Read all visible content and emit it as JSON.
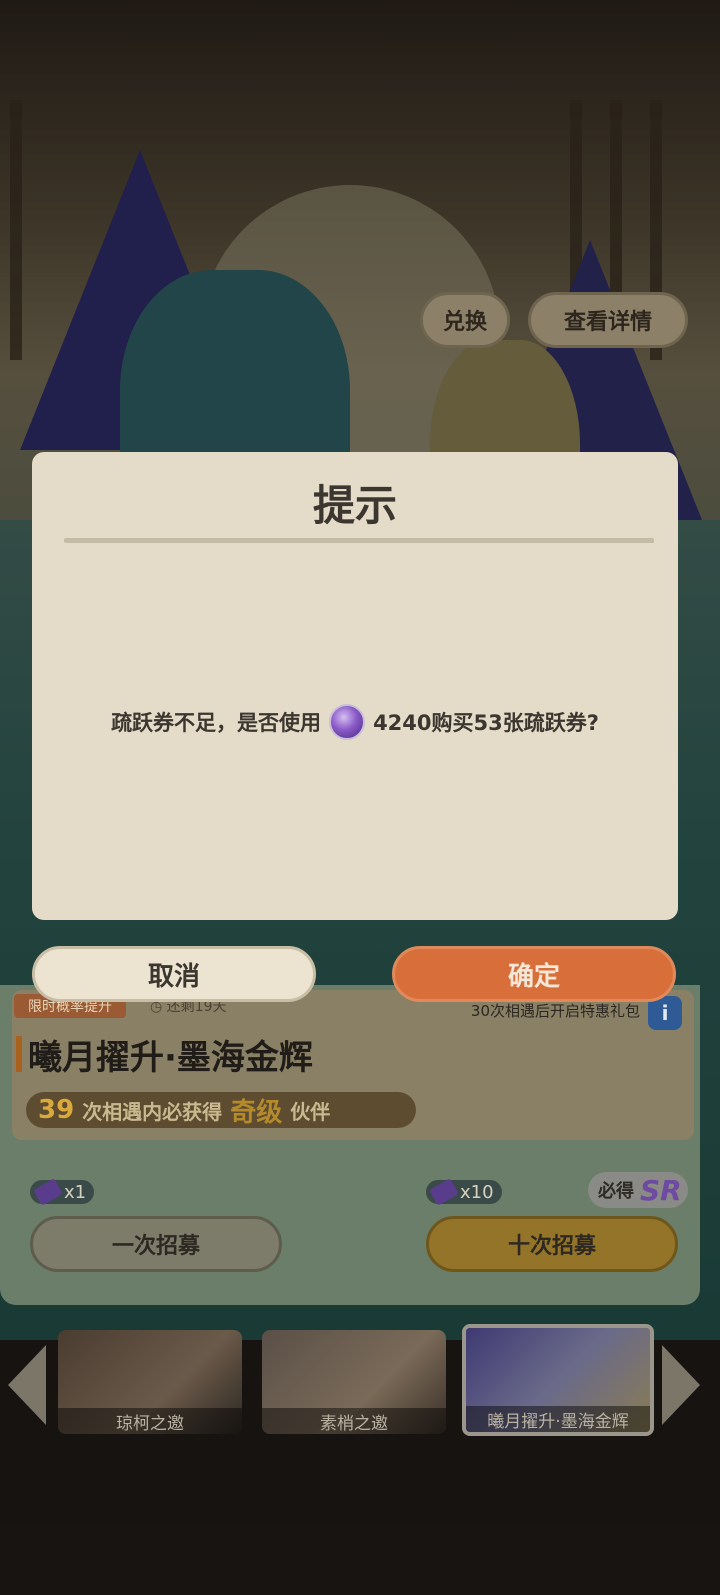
{
  "background": {
    "top_buttons": {
      "exchange_label": "兑换",
      "details_label": "查看详情"
    },
    "banner": {
      "limited_tag": "限时概率提升",
      "time_left": "还剩19天",
      "gift_note": "30次相遇后开启特惠礼包",
      "info_icon": "i",
      "title": "曦月擢升·墨海金辉",
      "guarantee_count": "39",
      "guarantee_text_1": "次相遇内必获得",
      "guarantee_rank": "奇级",
      "guarantee_text_2": "伙伴"
    },
    "recruit": {
      "one_cost": "x1",
      "ten_cost": "x10",
      "guaranteed_label": "必得",
      "guaranteed_rank": "SR",
      "one_label": "一次招募",
      "ten_label": "十次招募"
    },
    "carousel": {
      "items": [
        {
          "label": "琼柯之邀"
        },
        {
          "label": "素梢之邀"
        },
        {
          "label": "曦月擢升·墨海金辉"
        }
      ]
    }
  },
  "dialog": {
    "title": "提示",
    "message_before": "疏跃券不足，是否使用",
    "gem_icon": "purple-gem-icon",
    "message_after": "4240购买53张疏跃券?",
    "cancel_label": "取消",
    "confirm_label": "确定"
  },
  "colors": {
    "dialog_bg": "#e4dcc8",
    "confirm": "#d86f3a",
    "cancel": "#ece4d0"
  }
}
